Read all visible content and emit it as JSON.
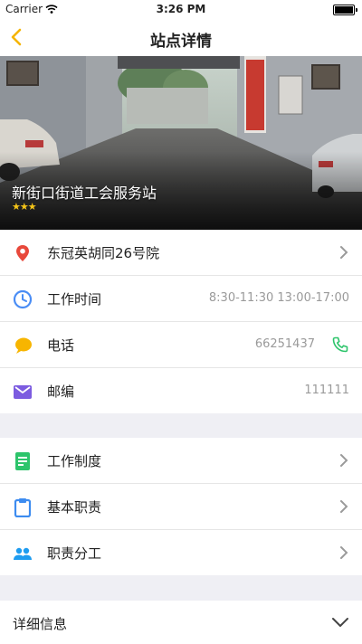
{
  "status_bar": {
    "carrier": "Carrier",
    "time": "3:26 PM"
  },
  "nav": {
    "title": "站点详情",
    "back_icon": "chevron-left-icon"
  },
  "hero": {
    "station_name": "新街口街道工会服务站",
    "rating_stars": "★★★",
    "rating": 3,
    "star_color": "#f5c518"
  },
  "info": {
    "address": "东冠英胡同26号院",
    "work_time_label": "工作时间",
    "work_time_value": "8:30-11:30 13:00-17:00",
    "phone_label": "电话",
    "phone_value": "66251437",
    "postcode_label": "邮编",
    "postcode_value": "111111"
  },
  "duties": {
    "system_label": "工作制度",
    "responsibility_label": "基本职责",
    "division_label": "职责分工"
  },
  "details": {
    "label": "详细信息"
  },
  "colors": {
    "accent": "#f5b400",
    "location": "#e8483b",
    "clock": "#4a8df5",
    "chat": "#f7b500",
    "mail": "#7c5ce0",
    "doc": "#2dc46b",
    "clipboard": "#3d8cf0",
    "people": "#1e9cf0",
    "phone": "#2dc46b"
  }
}
